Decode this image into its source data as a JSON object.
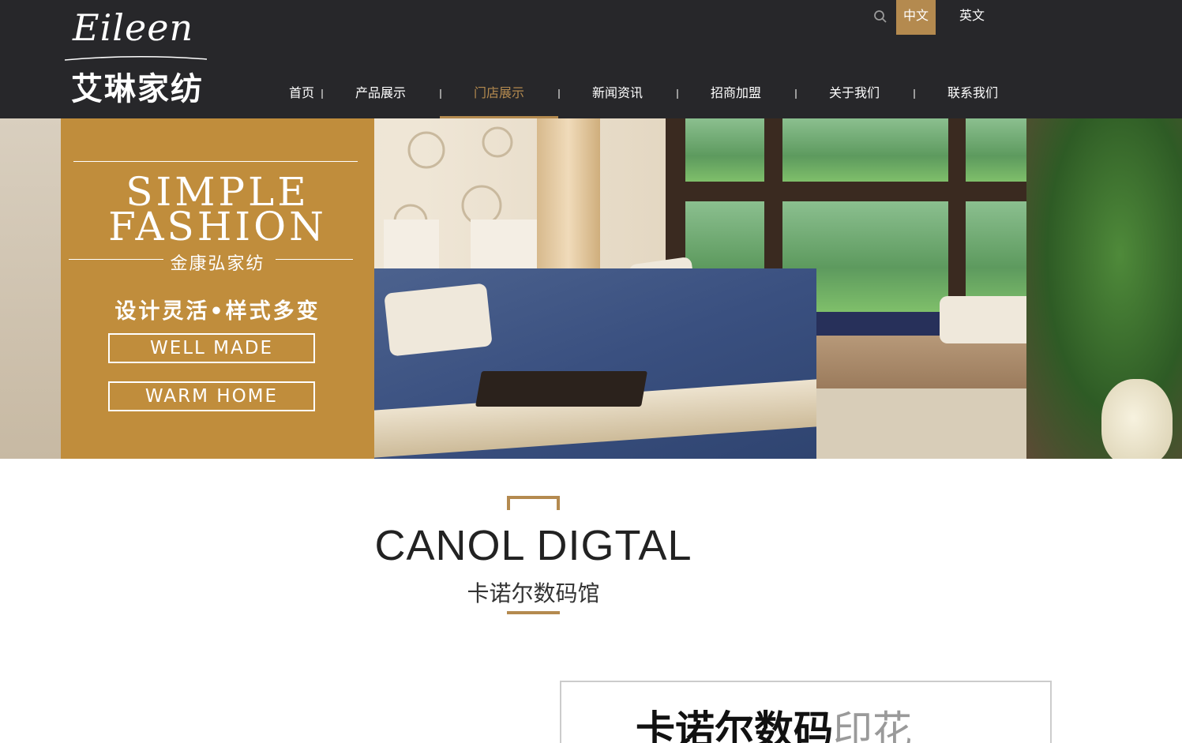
{
  "brand": {
    "logo_script": "Eileen",
    "logo_cn": "艾琳家纺"
  },
  "header": {
    "search_icon": "search-icon",
    "lang_zh": "中文",
    "lang_en": "英文",
    "colors": {
      "bar": "#27272a",
      "accent": "#b48a4f"
    }
  },
  "nav": {
    "items": [
      {
        "label": "首页",
        "active": false
      },
      {
        "label": "产品展示",
        "active": false
      },
      {
        "label": "门店展示",
        "active": true
      },
      {
        "label": "新闻资讯",
        "active": false
      },
      {
        "label": "招商加盟",
        "active": false
      },
      {
        "label": "关于我们",
        "active": false
      },
      {
        "label": "联系我们",
        "active": false
      }
    ]
  },
  "banner": {
    "line1": "SIMPLE",
    "line2": "FASHION",
    "brand": "金康弘家纺",
    "slogan": "设计灵活•样式多变",
    "box1": "WELL MADE",
    "box2": "WARM HOME",
    "promo_color": "#c08d3c"
  },
  "section": {
    "title": "CANOL DIGTAL",
    "subtitle": "卡诺尔数码馆"
  },
  "card": {
    "title_bold": "卡诺尔数码",
    "title_grey": "印花"
  }
}
